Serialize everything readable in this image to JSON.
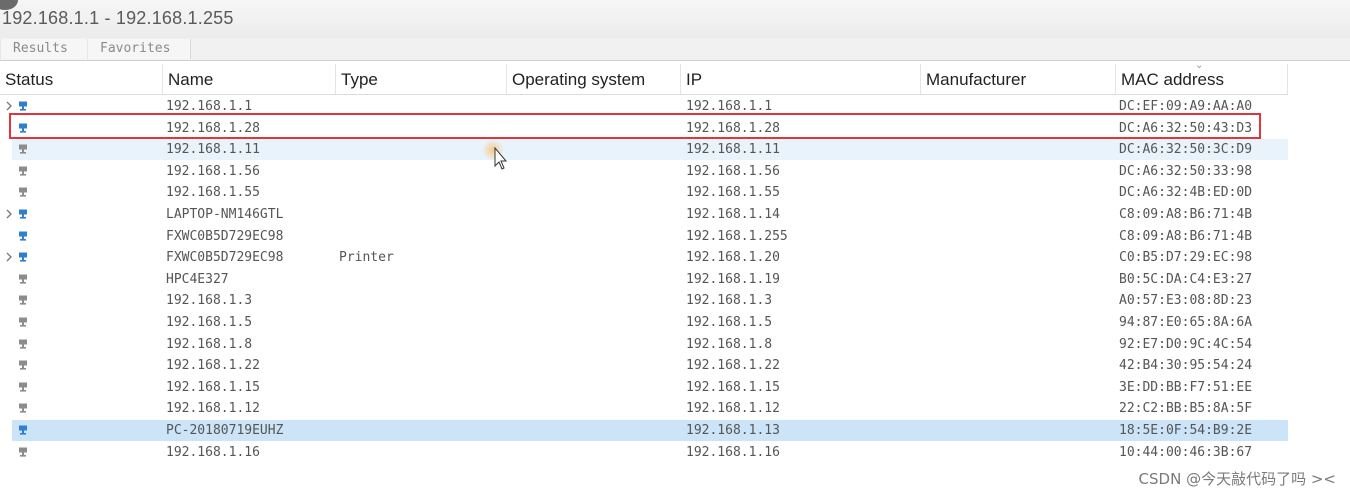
{
  "window": {
    "title": "192.168.1.1 - 192.168.1.255"
  },
  "tabs": [
    {
      "label": "Results"
    },
    {
      "label": "Favorites"
    }
  ],
  "columns": {
    "status": "Status",
    "name": "Name",
    "type": "Type",
    "os": "Operating system",
    "ip": "IP",
    "manufacturer": "Manufacturer",
    "mac": "MAC address"
  },
  "rows": [
    {
      "name": "192.168.1.1",
      "type": "",
      "ip": "192.168.1.1",
      "mac": "DC:EF:09:A9:AA:A0",
      "expandable": true
    },
    {
      "name": "192.168.1.28",
      "type": "",
      "ip": "192.168.1.28",
      "mac": "DC:A6:32:50:43:D3",
      "expandable": false
    },
    {
      "name": "192.168.1.11",
      "type": "",
      "ip": "192.168.1.11",
      "mac": "DC:A6:32:50:3C:D9",
      "expandable": false
    },
    {
      "name": "192.168.1.56",
      "type": "",
      "ip": "192.168.1.56",
      "mac": "DC:A6:32:50:33:98",
      "expandable": false
    },
    {
      "name": "192.168.1.55",
      "type": "",
      "ip": "192.168.1.55",
      "mac": "DC:A6:32:4B:ED:0D",
      "expandable": false
    },
    {
      "name": "LAPTOP-NM146GTL",
      "type": "",
      "ip": "192.168.1.14",
      "mac": "C8:09:A8:B6:71:4B",
      "expandable": true
    },
    {
      "name": "FXWC0B5D729EC98",
      "type": "",
      "ip": "192.168.1.255",
      "mac": "C8:09:A8:B6:71:4B",
      "expandable": false
    },
    {
      "name": "FXWC0B5D729EC98",
      "type": "Printer",
      "ip": "192.168.1.20",
      "mac": "C0:B5:D7:29:EC:98",
      "expandable": true
    },
    {
      "name": "HPC4E327",
      "type": "",
      "ip": "192.168.1.19",
      "mac": "B0:5C:DA:C4:E3:27",
      "expandable": false
    },
    {
      "name": "192.168.1.3",
      "type": "",
      "ip": "192.168.1.3",
      "mac": "A0:57:E3:08:8D:23",
      "expandable": false
    },
    {
      "name": "192.168.1.5",
      "type": "",
      "ip": "192.168.1.5",
      "mac": "94:87:E0:65:8A:6A",
      "expandable": false
    },
    {
      "name": "192.168.1.8",
      "type": "",
      "ip": "192.168.1.8",
      "mac": "92:E7:D0:9C:4C:54",
      "expandable": false
    },
    {
      "name": "192.168.1.22",
      "type": "",
      "ip": "192.168.1.22",
      "mac": "42:B4:30:95:54:24",
      "expandable": false
    },
    {
      "name": "192.168.1.15",
      "type": "",
      "ip": "192.168.1.15",
      "mac": "3E:DD:BB:F7:51:EE",
      "expandable": false
    },
    {
      "name": "192.168.1.12",
      "type": "",
      "ip": "192.168.1.12",
      "mac": "22:C2:BB:B5:8A:5F",
      "expandable": false
    },
    {
      "name": "PC-20180719EUHZ",
      "type": "",
      "ip": "192.168.1.13",
      "mac": "18:5E:0F:54:B9:2E",
      "expandable": false
    },
    {
      "name": "192.168.1.16",
      "type": "",
      "ip": "192.168.1.16",
      "mac": "10:44:00:46:3B:67",
      "expandable": false
    }
  ],
  "selected_row": 15,
  "hover_row": 2,
  "highlighted_row": 1,
  "watermark": "CSDN @今天敲代码了吗 ><",
  "colors": {
    "selection": "#cce4f7",
    "highlight_border": "#e0353a",
    "online_icon": "#2f7fd0",
    "offline_icon": "#8c8c8c"
  }
}
